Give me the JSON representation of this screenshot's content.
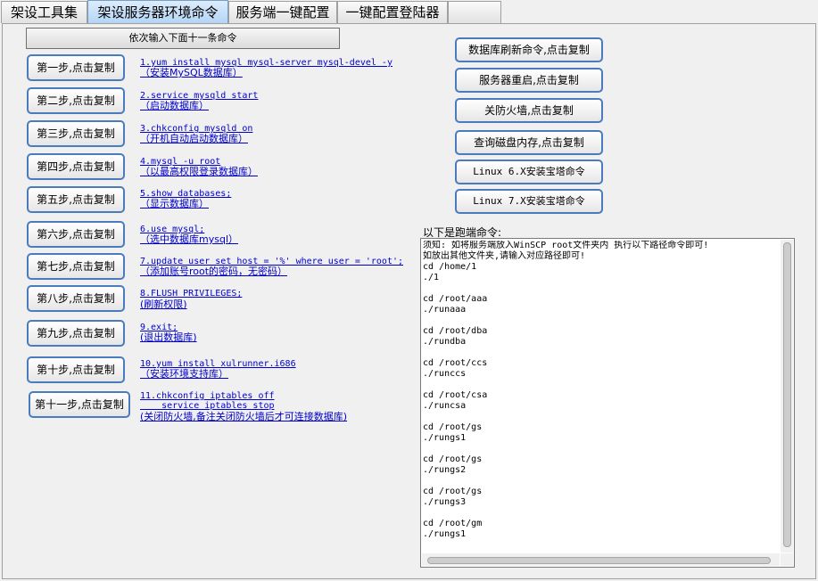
{
  "tabs": [
    {
      "label": "架设工具集"
    },
    {
      "label": "架设服务器环境命令"
    },
    {
      "label": "服务端一键配置"
    },
    {
      "label": "一键配置登陆器"
    },
    {
      "label": ""
    }
  ],
  "header_button": "依次输入下面十一条命令",
  "steps": [
    {
      "button": "第一步,点击复制",
      "command": "1.yum install mysql mysql-server mysql-devel -y",
      "note": "（安装MySQL数据库）"
    },
    {
      "button": "第二步,点击复制",
      "command": "2.service mysqld start",
      "note": "（启动数据库）"
    },
    {
      "button": "第三步,点击复制",
      "command": "3.chkconfig mysqld on",
      "note": "（开机自动启动数据库）"
    },
    {
      "button": "第四步,点击复制",
      "command": "4.mysql -u root",
      "note": "（以最高权限登录数据库）"
    },
    {
      "button": "第五步,点击复制",
      "command": "5.show databases;",
      "note": "（显示数据库）"
    },
    {
      "button": "第六步,点击复制",
      "command": "6.use mysql;",
      "note": "（选中数据库mysql）"
    },
    {
      "button": "第七步,点击复制",
      "command": "7.update user set host = '%' where user = 'root';",
      "note": "（添加账号root的密码，无密码）"
    },
    {
      "button": "第八步,点击复制",
      "command": "8.FLUSH PRIVILEGES;",
      "note": "(刷新权限)"
    },
    {
      "button": "第九步,点击复制",
      "command": "9.exit;",
      "note": "(退出数据库)"
    },
    {
      "button": "第十步,点击复制",
      "command": "10.yum install xulrunner.i686",
      "note": "（安装环境支持库）"
    },
    {
      "button": "第十一步,点击复制",
      "command": "11.chkconfig iptables off\n    service iptables stop",
      "note": "(关闭防火墙,备注关闭防火墙后才可连接数据库)"
    }
  ],
  "right_buttons": [
    "数据库刷新命令,点击复制",
    "服务器重启,点击复制",
    "关防火墙,点击复制",
    "查询磁盘内存,点击复制",
    "Linux 6.X安装宝塔命令",
    "Linux 7.X安装宝塔命令"
  ],
  "run_label": "以下是跑端命令:",
  "run_text": "须知: 如将服务端放入WinSCP root文件夹内 执行以下路径命令即可!\n如放出其他文件夹,请输入对应路径即可!\ncd /home/1\n./1\n\ncd /root/aaa\n./runaaa\n\ncd /root/dba\n./rundba\n\ncd /root/ccs\n./runccs\n\ncd /root/csa\n./runcsa\n\ncd /root/gs\n./rungs1\n\ncd /root/gs\n./rungs2\n\ncd /root/gs\n./rungs3\n\ncd /root/gm\n./rungs1"
}
